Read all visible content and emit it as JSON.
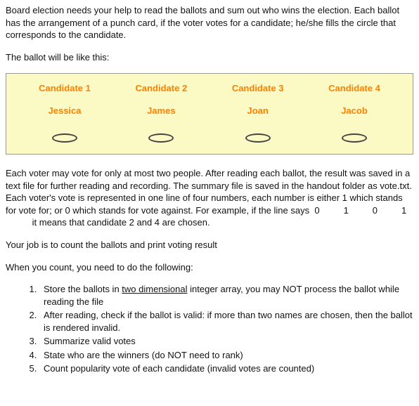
{
  "intro": "Board election needs your help to read the ballots and sum out who wins the election. Each ballot has the arrangement of a punch card, if the voter votes for a candidate; he/she fills the circle that corresponds to the candidate.",
  "ballot_lead": "The ballot will be like this:",
  "candidates": [
    {
      "title": "Candidate 1",
      "name": "Jessica"
    },
    {
      "title": "Candidate 2",
      "name": "James"
    },
    {
      "title": "Candidate 3",
      "name": "Joan"
    },
    {
      "title": "Candidate 4",
      "name": "Jacob"
    }
  ],
  "explain_pre": "Each voter may vote for only at most two people. After reading each ballot, the result was saved in a text file for further reading and recording. The summary file is saved in the handout folder as vote.txt. Each voter's vote is represented in one line of four numbers, each number is either 1 which stands for vote for; or 0 which stands for vote against. For example, if the line says",
  "example_nums": [
    "0",
    "1",
    "0",
    "1"
  ],
  "explain_post": "it means that candidate 2 and 4 are chosen.",
  "job": "Your job is to count the ballots and print voting result",
  "count_lead": "When you count, you need to do the following:",
  "steps": {
    "s1a": "Store the ballots in ",
    "s1u": "two dimensional",
    "s1b": " integer array, you may NOT process the ballot while reading the file",
    "s2": "After reading, check if the ballot is valid: if more than two names are chosen, then the ballot is rendered invalid.",
    "s3": "Summarize valid votes",
    "s4": "State who are the winners (do NOT need to rank)",
    "s5": "Count popularity vote of each candidate (invalid votes are counted)"
  }
}
